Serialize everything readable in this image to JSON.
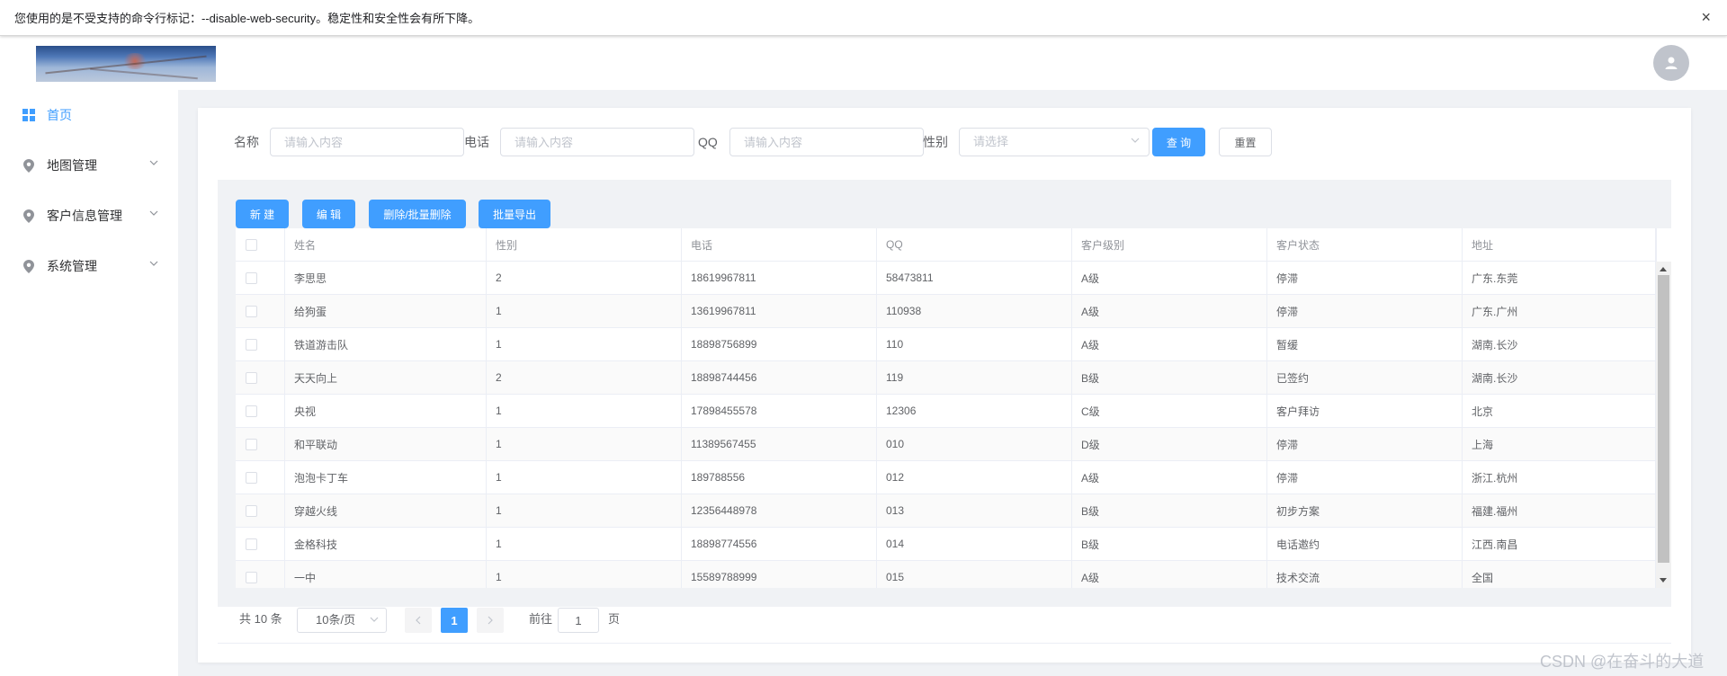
{
  "warning": {
    "text": "您使用的是不受支持的命令行标记：--disable-web-security。稳定性和安全性会有所下降。",
    "close": "×"
  },
  "header": {
    "logo_icon": "banner-image",
    "avatar_icon": "user-icon"
  },
  "sidebar": {
    "items": [
      {
        "label": "首页",
        "icon": "grid-icon",
        "active": true
      },
      {
        "label": "地图管理",
        "icon": "location-icon",
        "expandable": true
      },
      {
        "label": "客户信息管理",
        "icon": "location-icon",
        "expandable": true
      },
      {
        "label": "系统管理",
        "icon": "location-icon",
        "expandable": true
      }
    ]
  },
  "search": {
    "name_label": "名称",
    "name_placeholder": "请输入内容",
    "phone_label": "电话",
    "phone_placeholder": "请输入内容",
    "qq_label": "QQ",
    "qq_placeholder": "请输入内容",
    "gender_label": "性别",
    "gender_placeholder": "请选择",
    "query_button": "查 询",
    "reset_button": "重置"
  },
  "toolbar": {
    "new": "新 建",
    "edit": "编 辑",
    "delete": "删除/批量删除",
    "export": "批量导出"
  },
  "table": {
    "columns": [
      "姓名",
      "性别",
      "电话",
      "QQ",
      "客户级别",
      "客户状态",
      "地址"
    ],
    "rows": [
      [
        "李思思",
        "2",
        "18619967811",
        "58473811",
        "A级",
        "停滞",
        "广东.东莞"
      ],
      [
        "给狗蛋",
        "1",
        "13619967811",
        "110938",
        "A级",
        "停滞",
        "广东.广州"
      ],
      [
        "铁道游击队",
        "1",
        "18898756899",
        "110",
        "A级",
        "暂缓",
        "湖南.长沙"
      ],
      [
        "天天向上",
        "2",
        "18898744456",
        "119",
        "B级",
        "已签约",
        "湖南.长沙"
      ],
      [
        "央视",
        "1",
        "17898455578",
        "12306",
        "C级",
        "客户拜访",
        "北京"
      ],
      [
        "和平联动",
        "1",
        "11389567455",
        "010",
        "D级",
        "停滞",
        "上海"
      ],
      [
        "泡泡卡丁车",
        "1",
        "189788556",
        "012",
        "A级",
        "停滞",
        "浙江.杭州"
      ],
      [
        "穿越火线",
        "1",
        "12356448978",
        "013",
        "B级",
        "初步方案",
        "福建.福州"
      ],
      [
        "金格科技",
        "1",
        "18898774556",
        "014",
        "B级",
        "电话邀约",
        "江西.南昌"
      ],
      [
        "一中",
        "1",
        "15589788999",
        "015",
        "A级",
        "技术交流",
        "全国"
      ]
    ]
  },
  "pagination": {
    "total": "共 10 条",
    "page_size": "10条/页",
    "prev_icon": "chevron-left-icon",
    "current": "1",
    "next_icon": "chevron-right-icon",
    "goto_label": "前往",
    "goto_value": "1",
    "page_suffix": "页"
  },
  "watermark": "CSDN @在奋斗的大道",
  "colors": {
    "primary": "#409eff",
    "background": "#f0f2f5",
    "border": "#dcdfe6"
  }
}
